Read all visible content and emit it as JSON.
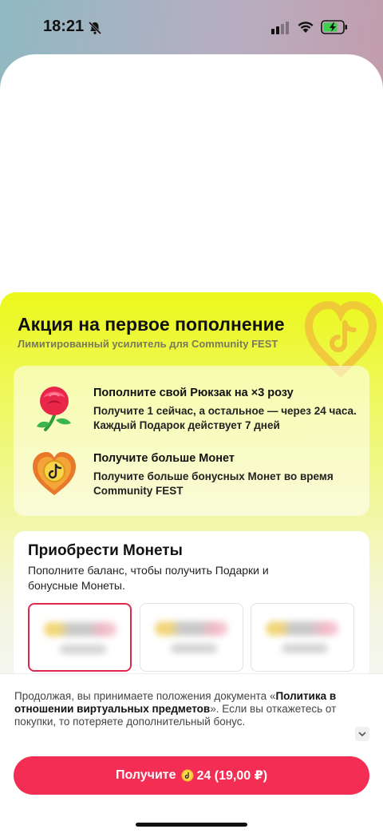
{
  "status_bar": {
    "time": "18:21"
  },
  "promo": {
    "title": "Акция на первое пополнение",
    "subtitle": "Лимитированный усилитель для Community FEST",
    "benefits": [
      {
        "title": "Пополните свой Рюкзак на ×3 розу",
        "description": "Получите 1 сейчас, а остальное — через 24 часа. Каждый Подарок действует 7 дней",
        "icon": "rose-icon"
      },
      {
        "title": "Получите больше Монет",
        "description": "Получите больше бонусных Монет во время Community FEST",
        "icon": "coin-heart-icon"
      }
    ]
  },
  "coins": {
    "title": "Приобрести Монеты",
    "description": "Пополните баланс, чтобы получить Подарки и бонусные Монеты.",
    "packages_selected_index": 0
  },
  "legal": {
    "prefix": "Продолжая, вы принимаете положения документа «",
    "link": "Политика в отношении виртуальных предметов",
    "suffix": "». Если вы откажетесь от покупки, то потеряете дополнительный бонус."
  },
  "cta": {
    "label_prefix": "Получите",
    "amount": "24 (19,00 ₽)"
  },
  "colors": {
    "accent": "#f42d54",
    "promo_yellow": "#ecf81a"
  }
}
